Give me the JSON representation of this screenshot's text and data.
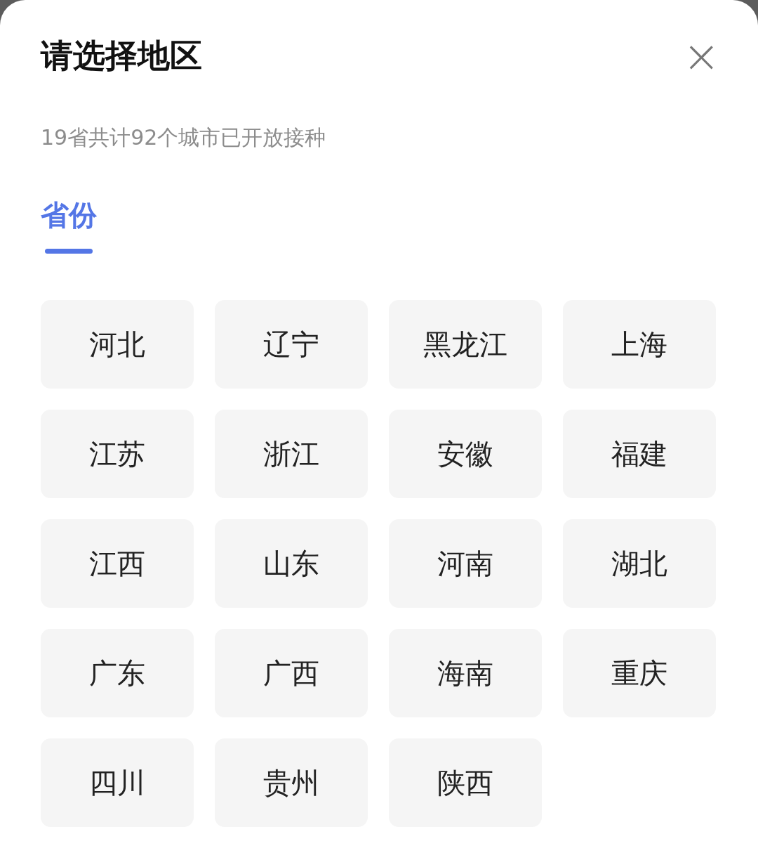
{
  "dialog": {
    "title": "请选择地区",
    "close": "×"
  },
  "subtitle": "19省共计92个城市已开放接种",
  "tabs": [
    {
      "label": "省份",
      "selected": true
    }
  ],
  "regions": [
    "河北",
    "辽宁",
    "黑龙江",
    "上海",
    "江苏",
    "浙江",
    "安徽",
    "福建",
    "江西",
    "山东",
    "河南",
    "湖北",
    "广东",
    "广西",
    "海南",
    "重庆",
    "四川",
    "贵州",
    "陕西"
  ]
}
